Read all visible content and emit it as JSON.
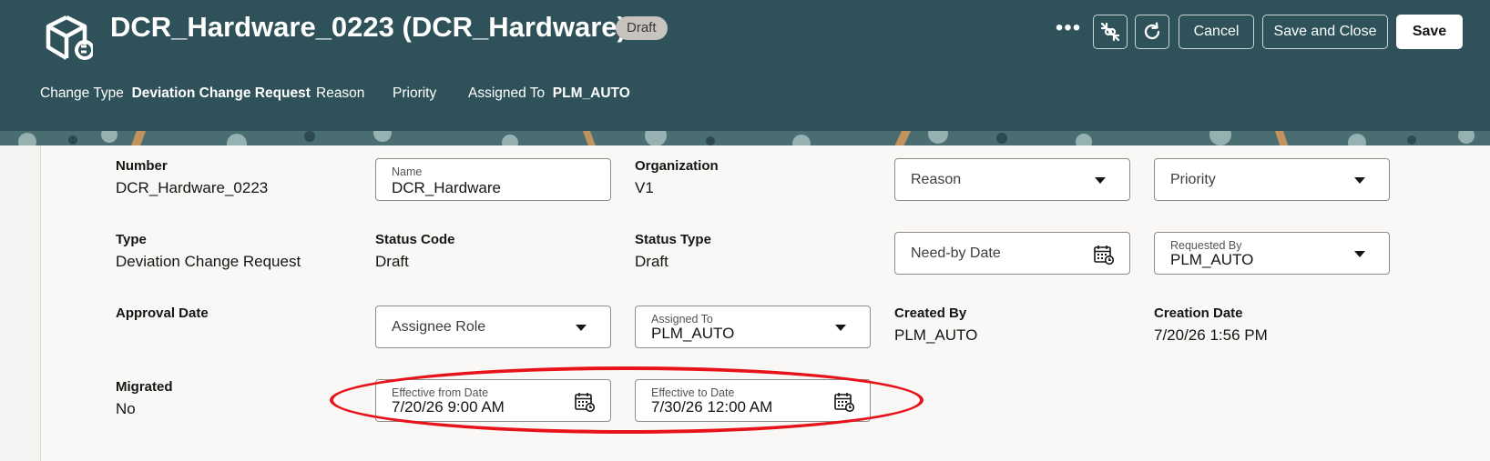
{
  "header": {
    "title": "DCR_Hardware_0223 (DCR_Hardware)",
    "status_badge": "Draft",
    "more_label": "•••",
    "cancel_label": "Cancel",
    "save_close_label": "Save and Close",
    "save_label": "Save"
  },
  "subbar": {
    "change_type_label": "Change Type",
    "change_type_value": "Deviation Change Request",
    "reason_label": "Reason",
    "priority_label": "Priority",
    "assigned_to_label": "Assigned To",
    "assigned_to_value": "PLM_AUTO"
  },
  "form": {
    "number": {
      "label": "Number",
      "value": "DCR_Hardware_0223"
    },
    "name": {
      "label": "Name",
      "value": "DCR_Hardware"
    },
    "organization": {
      "label": "Organization",
      "value": "V1"
    },
    "reason": {
      "placeholder": "Reason"
    },
    "priority": {
      "placeholder": "Priority"
    },
    "type": {
      "label": "Type",
      "value": "Deviation Change Request"
    },
    "status_code": {
      "label": "Status Code",
      "value": "Draft"
    },
    "status_type": {
      "label": "Status Type",
      "value": "Draft"
    },
    "need_by_date": {
      "placeholder": "Need-by Date"
    },
    "requested_by": {
      "label": "Requested By",
      "value": "PLM_AUTO"
    },
    "approval_date": {
      "label": "Approval Date"
    },
    "assignee_role": {
      "placeholder": "Assignee Role"
    },
    "assigned_to": {
      "label": "Assigned To",
      "value": "PLM_AUTO"
    },
    "created_by": {
      "label": "Created By",
      "value": "PLM_AUTO"
    },
    "creation_date": {
      "label": "Creation Date",
      "value": "7/20/26 1:56 PM"
    },
    "migrated": {
      "label": "Migrated",
      "value": "No"
    },
    "effective_from": {
      "label": "Effective from Date",
      "value": "7/20/26 9:00 AM"
    },
    "effective_to": {
      "label": "Effective to Date",
      "value": "7/30/26 12:00 AM"
    }
  },
  "colors": {
    "header_bg": "#2f525a",
    "highlight": "#e8131a",
    "badge_bg": "#c7c4bf"
  }
}
